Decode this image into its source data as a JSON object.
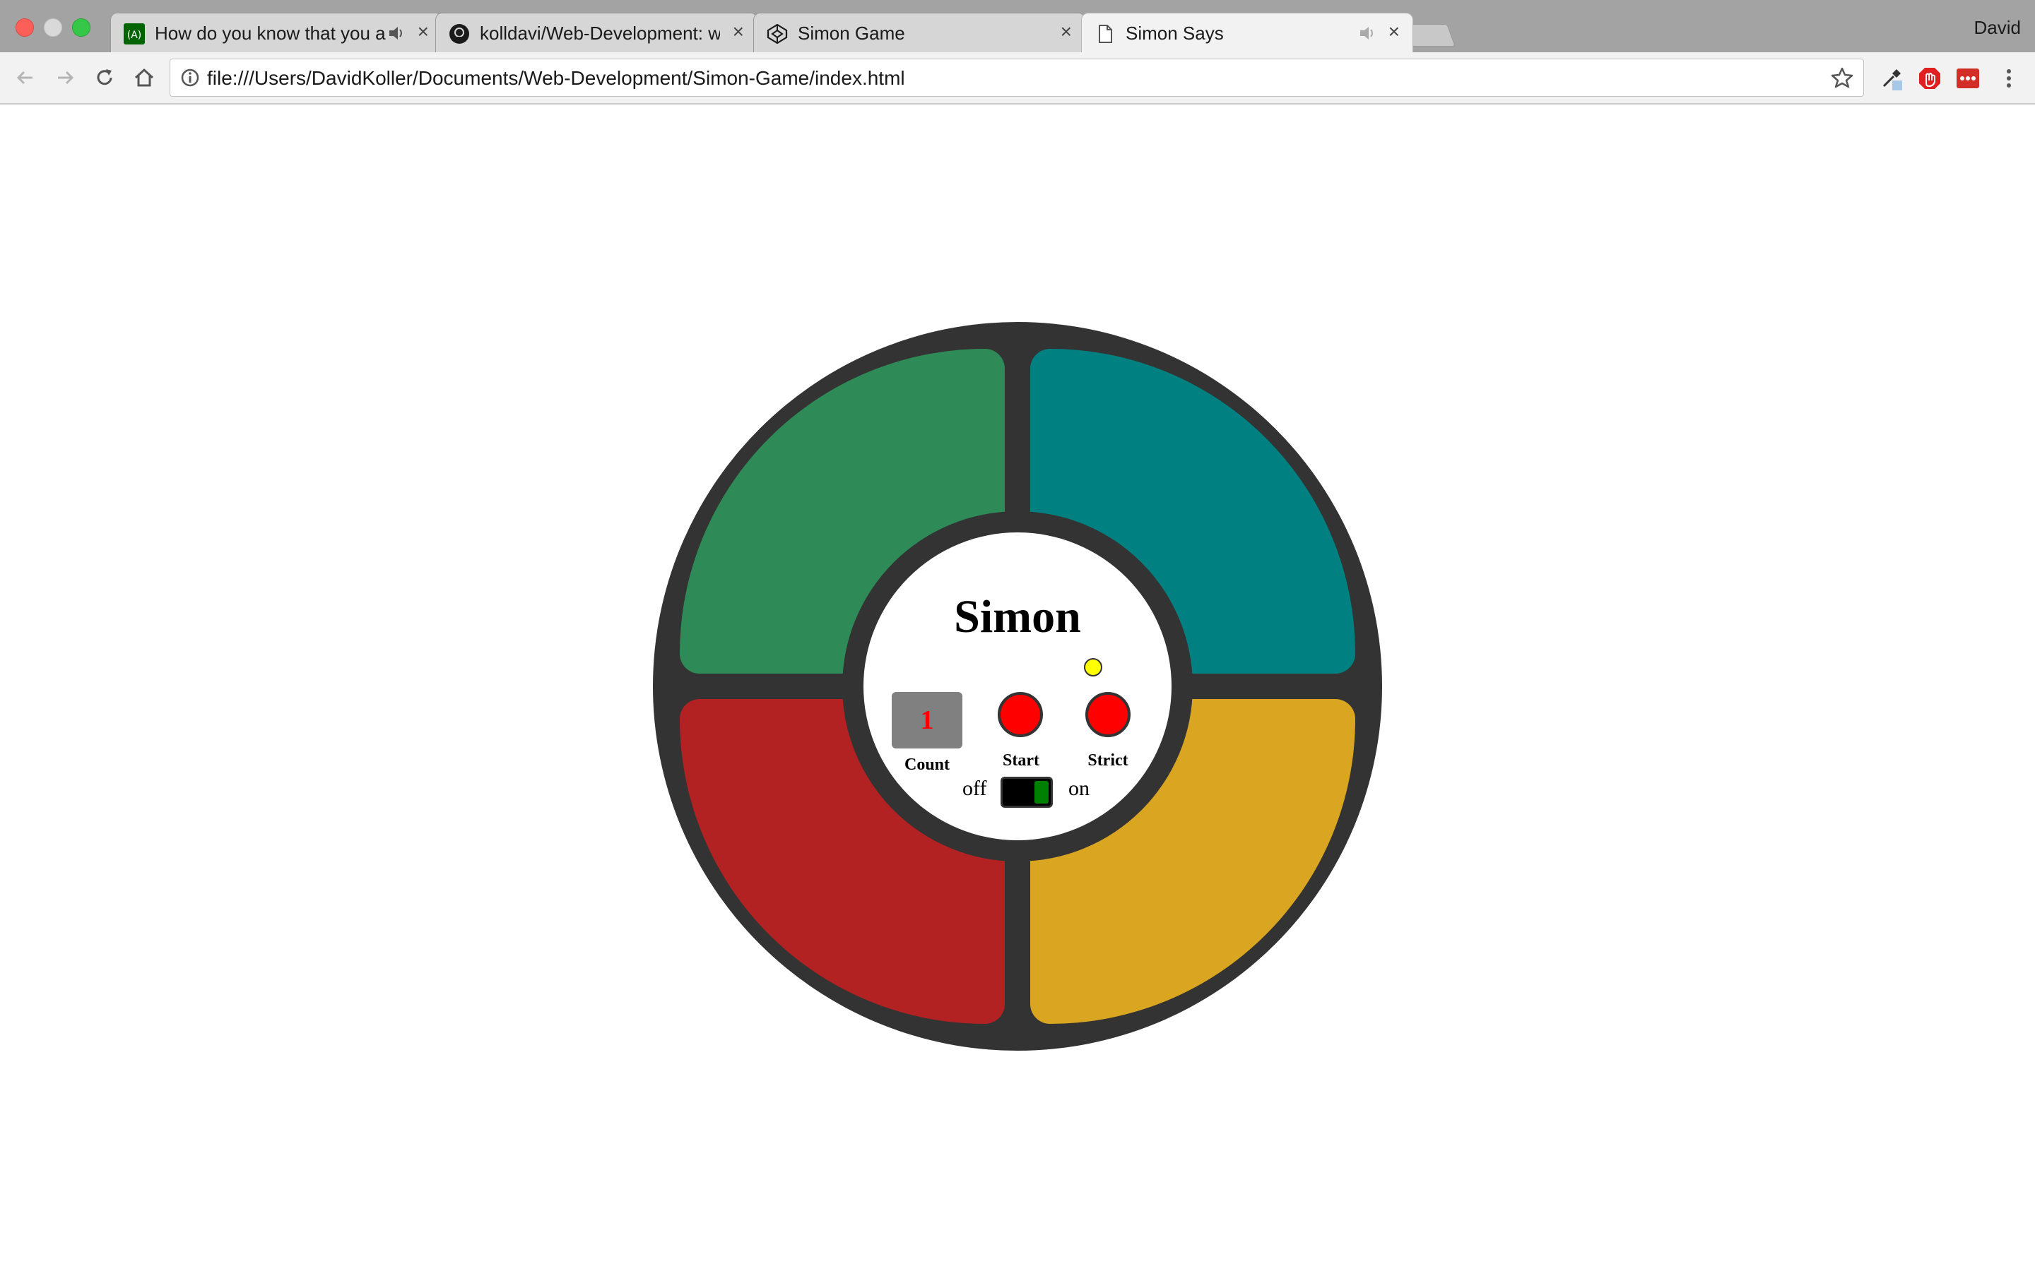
{
  "browser": {
    "tabs": [
      {
        "title": "How do you know that you a",
        "has_audio": true,
        "active": false
      },
      {
        "title": "kolldavi/Web-Development: we",
        "has_audio": false,
        "active": false
      },
      {
        "title": "Simon Game",
        "has_audio": false,
        "active": false
      },
      {
        "title": "Simon Says",
        "has_audio": true,
        "active": true
      }
    ],
    "profile_name": "David",
    "url": "file:///Users/DavidKoller/Documents/Web-Development/Simon-Game/index.html",
    "close_glyph": "×"
  },
  "game": {
    "title": "Simon",
    "count": "1",
    "start_label": "Start",
    "strict_label": "Strict",
    "count_label": "Count",
    "off_label": "off",
    "on_label": "on",
    "power_on": true,
    "strict_led_color": "#ffff00",
    "colors": {
      "green": "#2e8b57",
      "teal": "#008080",
      "red": "#b22222",
      "yellow": "#daa520",
      "frame": "#333333"
    }
  }
}
